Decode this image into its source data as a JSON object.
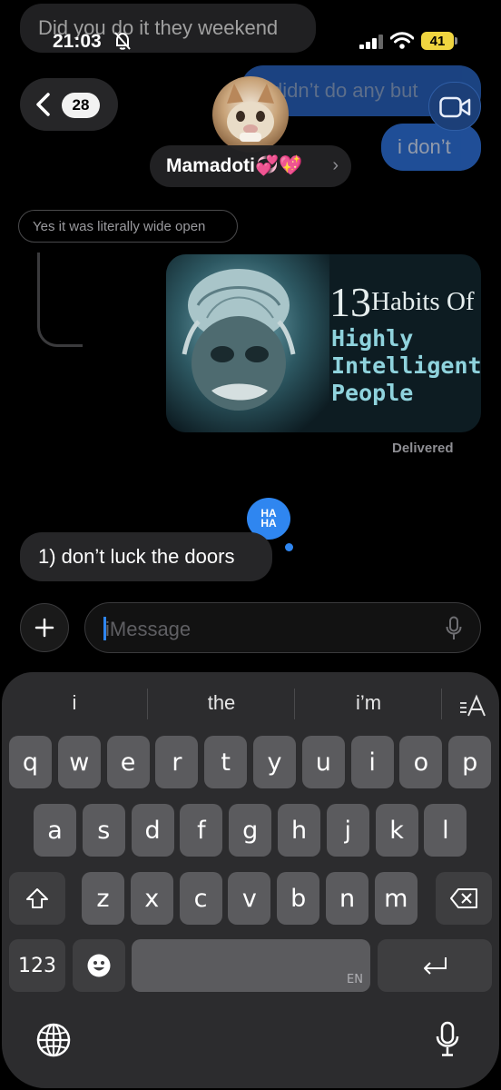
{
  "status_bar": {
    "time": "21:03",
    "battery": "41"
  },
  "header": {
    "back_count": "28",
    "contact_name": "Mamadoti💞💖",
    "chevron": "›"
  },
  "messages": {
    "top_incoming": "Did you do it they weekend",
    "outgoing_1": "i didn’t do any but",
    "outgoing_2": "i don’t",
    "reply_quote": "Yes it was literally wide open",
    "image_card": {
      "number": "13",
      "line1": "Habits Of",
      "line2": "Highly",
      "line3": "Intelligent",
      "line4": "People"
    },
    "delivered": "Delivered",
    "tapback": "HA HA",
    "last_incoming": "1) don’t luck the doors"
  },
  "composer": {
    "placeholder": "iMessage"
  },
  "keyboard": {
    "suggestions": [
      "i",
      "the",
      "i’m"
    ],
    "row1": [
      "q",
      "w",
      "e",
      "r",
      "t",
      "y",
      "u",
      "i",
      "o",
      "p"
    ],
    "row2": [
      "a",
      "s",
      "d",
      "f",
      "g",
      "h",
      "j",
      "k",
      "l"
    ],
    "row3": [
      "z",
      "x",
      "c",
      "v",
      "b",
      "n",
      "m"
    ],
    "numbers_label": "123",
    "language_label": "EN"
  },
  "colors": {
    "accent_blue": "#2d6fd7",
    "incoming_gray": "#262628",
    "battery_yellow": "#f0d540"
  }
}
